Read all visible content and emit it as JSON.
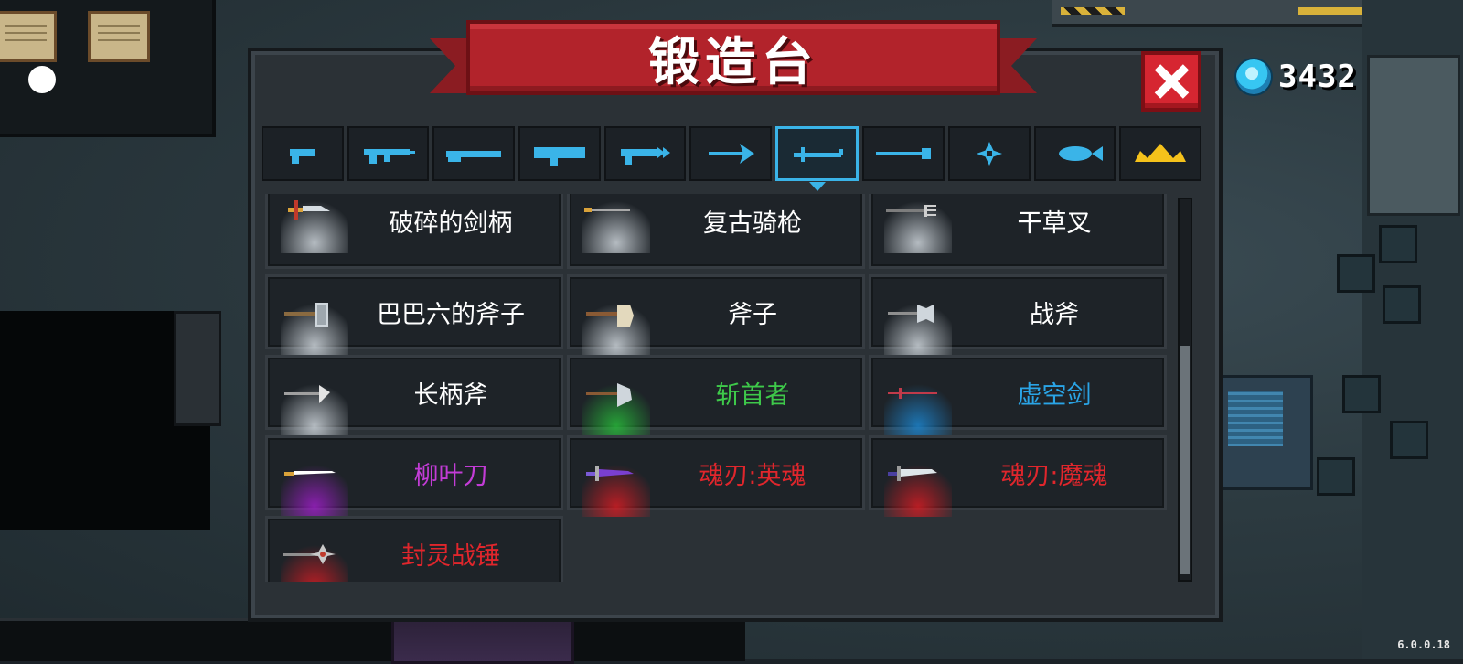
{
  "title": "锻造台",
  "gems": {
    "count": "3432"
  },
  "version": "6.0.0.18",
  "tabs": [
    {
      "icon": "pistol-icon",
      "color": "#3ab4e8"
    },
    {
      "icon": "assault-rifle-icon",
      "color": "#3ab4e8"
    },
    {
      "icon": "shotgun-icon",
      "color": "#3ab4e8"
    },
    {
      "icon": "launcher-icon",
      "color": "#3ab4e8"
    },
    {
      "icon": "laser-gun-icon",
      "color": "#3ab4e8"
    },
    {
      "icon": "bow-icon",
      "color": "#3ab4e8"
    },
    {
      "icon": "melee-weapon-icon",
      "color": "#3ab4e8",
      "active": true
    },
    {
      "icon": "staff-icon",
      "color": "#3ab4e8"
    },
    {
      "icon": "shuriken-icon",
      "color": "#3ab4e8"
    },
    {
      "icon": "fish-icon",
      "color": "#3ab4e8"
    },
    {
      "icon": "crown-icon",
      "color": "#f5c21b"
    }
  ],
  "items": [
    {
      "name": "破碎的剑柄",
      "color": "#ffffff",
      "glow": "#cfd6dc",
      "icon": "broken-sword-hilt-icon"
    },
    {
      "name": "复古骑枪",
      "color": "#ffffff",
      "glow": "#cfd6dc",
      "icon": "retro-lance-icon"
    },
    {
      "name": "干草叉",
      "color": "#ffffff",
      "glow": "#cfd6dc",
      "icon": "pitchfork-icon"
    },
    {
      "name": "巴巴六的斧子",
      "color": "#ffffff",
      "glow": "#cfd6dc",
      "icon": "hatchet-icon"
    },
    {
      "name": "斧子",
      "color": "#ffffff",
      "glow": "#cfd6dc",
      "icon": "axe-icon"
    },
    {
      "name": "战斧",
      "color": "#ffffff",
      "glow": "#cfd6dc",
      "icon": "battle-axe-icon"
    },
    {
      "name": "长柄斧",
      "color": "#ffffff",
      "glow": "#cfd6dc",
      "icon": "halberd-icon"
    },
    {
      "name": "斩首者",
      "color": "#3ec94a",
      "glow": "#28b83a",
      "icon": "executioner-axe-icon"
    },
    {
      "name": "虚空剑",
      "color": "#2aa4e6",
      "glow": "#1d84cc",
      "icon": "void-sword-icon"
    },
    {
      "name": "柳叶刀",
      "color": "#c23cd6",
      "glow": "#9b1fc4",
      "icon": "willow-blade-icon"
    },
    {
      "name": "魂刃:英魂",
      "color": "#e0262c",
      "glow": "#d11d24",
      "icon": "soul-blade-hero-icon"
    },
    {
      "name": "魂刃:魔魂",
      "color": "#e0262c",
      "glow": "#d11d24",
      "icon": "soul-blade-demon-icon"
    },
    {
      "name": "封灵战锤",
      "color": "#e0262c",
      "glow": "#d11d24",
      "icon": "spirit-seal-hammer-icon"
    }
  ]
}
